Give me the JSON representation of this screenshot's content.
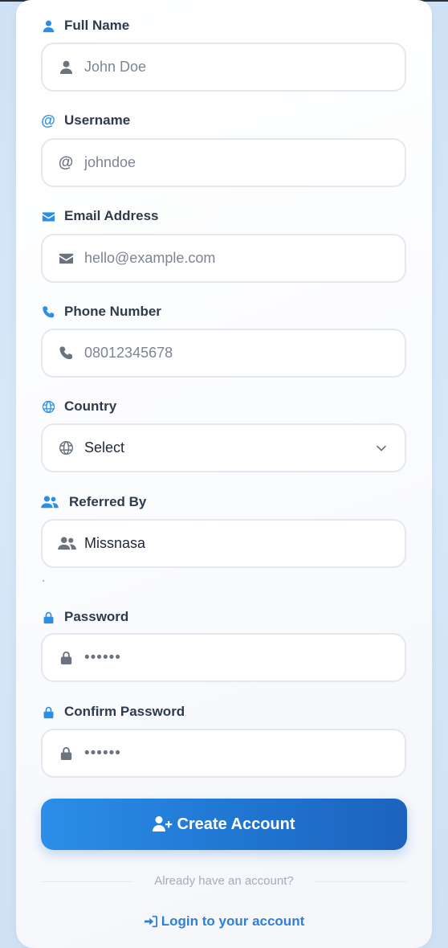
{
  "form": {
    "full_name": {
      "label": "Full Name",
      "placeholder": "John Doe",
      "icon": "user-icon"
    },
    "username": {
      "label": "Username",
      "placeholder": "johndoe",
      "icon": "at-icon"
    },
    "email": {
      "label": "Email Address",
      "placeholder": "hello@example.com",
      "icon": "envelope-icon"
    },
    "phone": {
      "label": "Phone Number",
      "placeholder": "08012345678",
      "icon": "phone-icon"
    },
    "country": {
      "label": "Country",
      "value": "Select",
      "icon": "globe-icon"
    },
    "referred_by": {
      "label": "Referred By",
      "value": "Missnasa",
      "icon": "users-icon"
    },
    "password": {
      "label": "Password",
      "value": "••••••",
      "icon": "lock-icon"
    },
    "confirm_password": {
      "label": "Confirm Password",
      "value": "••••••",
      "icon": "lock-icon"
    }
  },
  "actions": {
    "create_account": "Create Account",
    "already_text": "Already have an account?",
    "login": "Login to your account"
  },
  "colors": {
    "accent": "#2d8ee6",
    "button_start": "#2b8ee8",
    "button_end": "#1c63bd",
    "link": "#2d7fd8"
  }
}
